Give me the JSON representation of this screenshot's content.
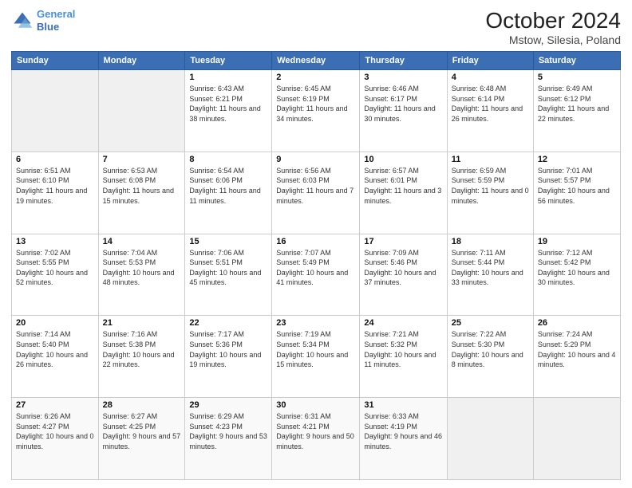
{
  "header": {
    "logo_line1": "General",
    "logo_line2": "Blue",
    "title": "October 2024",
    "subtitle": "Mstow, Silesia, Poland"
  },
  "weekdays": [
    "Sunday",
    "Monday",
    "Tuesday",
    "Wednesday",
    "Thursday",
    "Friday",
    "Saturday"
  ],
  "weeks": [
    [
      {
        "day": "",
        "empty": true
      },
      {
        "day": "",
        "empty": true
      },
      {
        "day": "1",
        "sunrise": "6:43 AM",
        "sunset": "6:21 PM",
        "daylight": "11 hours and 38 minutes."
      },
      {
        "day": "2",
        "sunrise": "6:45 AM",
        "sunset": "6:19 PM",
        "daylight": "11 hours and 34 minutes."
      },
      {
        "day": "3",
        "sunrise": "6:46 AM",
        "sunset": "6:17 PM",
        "daylight": "11 hours and 30 minutes."
      },
      {
        "day": "4",
        "sunrise": "6:48 AM",
        "sunset": "6:14 PM",
        "daylight": "11 hours and 26 minutes."
      },
      {
        "day": "5",
        "sunrise": "6:49 AM",
        "sunset": "6:12 PM",
        "daylight": "11 hours and 22 minutes."
      }
    ],
    [
      {
        "day": "6",
        "sunrise": "6:51 AM",
        "sunset": "6:10 PM",
        "daylight": "11 hours and 19 minutes."
      },
      {
        "day": "7",
        "sunrise": "6:53 AM",
        "sunset": "6:08 PM",
        "daylight": "11 hours and 15 minutes."
      },
      {
        "day": "8",
        "sunrise": "6:54 AM",
        "sunset": "6:06 PM",
        "daylight": "11 hours and 11 minutes."
      },
      {
        "day": "9",
        "sunrise": "6:56 AM",
        "sunset": "6:03 PM",
        "daylight": "11 hours and 7 minutes."
      },
      {
        "day": "10",
        "sunrise": "6:57 AM",
        "sunset": "6:01 PM",
        "daylight": "11 hours and 3 minutes."
      },
      {
        "day": "11",
        "sunrise": "6:59 AM",
        "sunset": "5:59 PM",
        "daylight": "11 hours and 0 minutes."
      },
      {
        "day": "12",
        "sunrise": "7:01 AM",
        "sunset": "5:57 PM",
        "daylight": "10 hours and 56 minutes."
      }
    ],
    [
      {
        "day": "13",
        "sunrise": "7:02 AM",
        "sunset": "5:55 PM",
        "daylight": "10 hours and 52 minutes."
      },
      {
        "day": "14",
        "sunrise": "7:04 AM",
        "sunset": "5:53 PM",
        "daylight": "10 hours and 48 minutes."
      },
      {
        "day": "15",
        "sunrise": "7:06 AM",
        "sunset": "5:51 PM",
        "daylight": "10 hours and 45 minutes."
      },
      {
        "day": "16",
        "sunrise": "7:07 AM",
        "sunset": "5:49 PM",
        "daylight": "10 hours and 41 minutes."
      },
      {
        "day": "17",
        "sunrise": "7:09 AM",
        "sunset": "5:46 PM",
        "daylight": "10 hours and 37 minutes."
      },
      {
        "day": "18",
        "sunrise": "7:11 AM",
        "sunset": "5:44 PM",
        "daylight": "10 hours and 33 minutes."
      },
      {
        "day": "19",
        "sunrise": "7:12 AM",
        "sunset": "5:42 PM",
        "daylight": "10 hours and 30 minutes."
      }
    ],
    [
      {
        "day": "20",
        "sunrise": "7:14 AM",
        "sunset": "5:40 PM",
        "daylight": "10 hours and 26 minutes."
      },
      {
        "day": "21",
        "sunrise": "7:16 AM",
        "sunset": "5:38 PM",
        "daylight": "10 hours and 22 minutes."
      },
      {
        "day": "22",
        "sunrise": "7:17 AM",
        "sunset": "5:36 PM",
        "daylight": "10 hours and 19 minutes."
      },
      {
        "day": "23",
        "sunrise": "7:19 AM",
        "sunset": "5:34 PM",
        "daylight": "10 hours and 15 minutes."
      },
      {
        "day": "24",
        "sunrise": "7:21 AM",
        "sunset": "5:32 PM",
        "daylight": "10 hours and 11 minutes."
      },
      {
        "day": "25",
        "sunrise": "7:22 AM",
        "sunset": "5:30 PM",
        "daylight": "10 hours and 8 minutes."
      },
      {
        "day": "26",
        "sunrise": "7:24 AM",
        "sunset": "5:29 PM",
        "daylight": "10 hours and 4 minutes."
      }
    ],
    [
      {
        "day": "27",
        "sunrise": "6:26 AM",
        "sunset": "4:27 PM",
        "daylight": "10 hours and 0 minutes.",
        "lastrow": true
      },
      {
        "day": "28",
        "sunrise": "6:27 AM",
        "sunset": "4:25 PM",
        "daylight": "9 hours and 57 minutes.",
        "lastrow": true
      },
      {
        "day": "29",
        "sunrise": "6:29 AM",
        "sunset": "4:23 PM",
        "daylight": "9 hours and 53 minutes.",
        "lastrow": true
      },
      {
        "day": "30",
        "sunrise": "6:31 AM",
        "sunset": "4:21 PM",
        "daylight": "9 hours and 50 minutes.",
        "lastrow": true
      },
      {
        "day": "31",
        "sunrise": "6:33 AM",
        "sunset": "4:19 PM",
        "daylight": "9 hours and 46 minutes.",
        "lastrow": true
      },
      {
        "day": "",
        "empty": true,
        "lastrow": true
      },
      {
        "day": "",
        "empty": true,
        "lastrow": true
      }
    ]
  ]
}
